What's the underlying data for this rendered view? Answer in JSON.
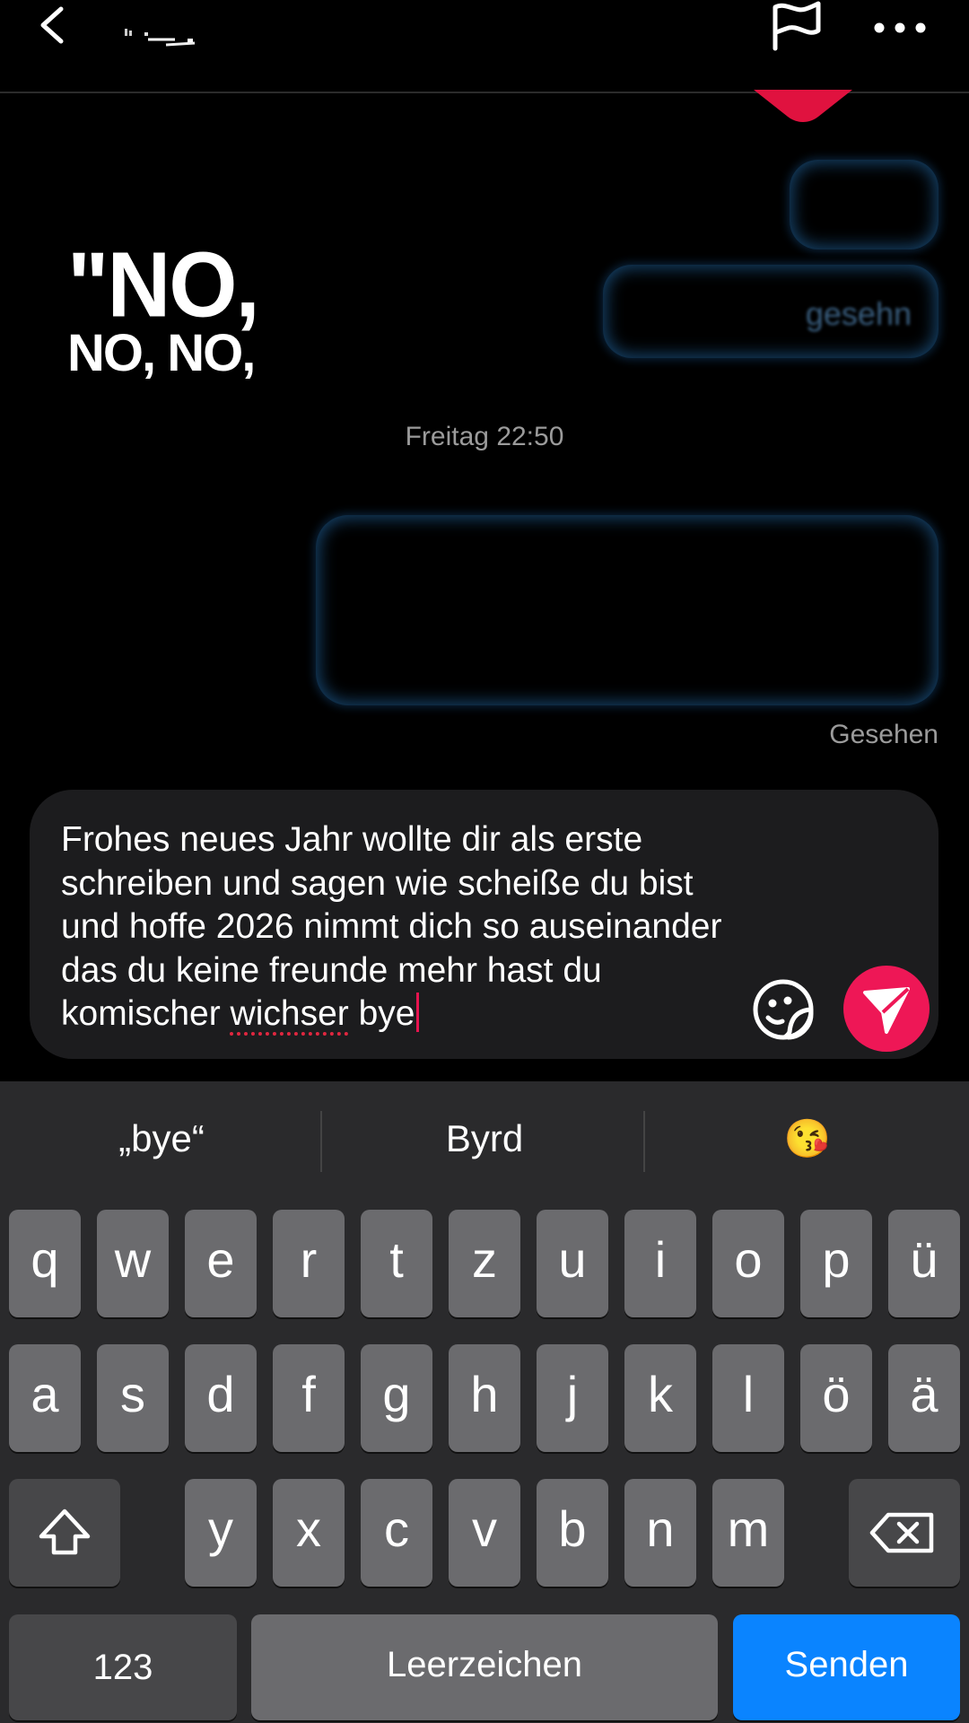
{
  "header": {
    "username": "· ._",
    "icons": [
      "chevron-left-icon",
      "flag-icon",
      "more-horizontal-icon"
    ]
  },
  "chat": {
    "sticker_line1": "\"NO,",
    "sticker_line2": "NO, NO,",
    "blurred_fragment_1": "gesehn",
    "timestamp": "Freitag 22:50",
    "seen": "Gesehen"
  },
  "composer": {
    "text_before": "Frohes neues Jahr wollte dir als erste schreiben und sagen wie scheiße du bist und hoffe 2026 nimmt dich so auseinander das du keine freunde mehr hast du komischer ",
    "text_misspelled": "wichser",
    "text_after": " bye",
    "accent_color": "#ee1756"
  },
  "keyboard": {
    "suggestions": [
      "„bye“",
      "Byrd",
      "😘"
    ],
    "row1": [
      "q",
      "w",
      "e",
      "r",
      "t",
      "z",
      "u",
      "i",
      "o",
      "p",
      "ü"
    ],
    "row2": [
      "a",
      "s",
      "d",
      "f",
      "g",
      "h",
      "j",
      "k",
      "l",
      "ö",
      "ä"
    ],
    "row3": [
      "y",
      "x",
      "c",
      "v",
      "b",
      "n",
      "m"
    ],
    "key_123": "123",
    "key_space": "Leerzeichen",
    "key_send": "Senden",
    "send_color": "#0a84ff"
  }
}
